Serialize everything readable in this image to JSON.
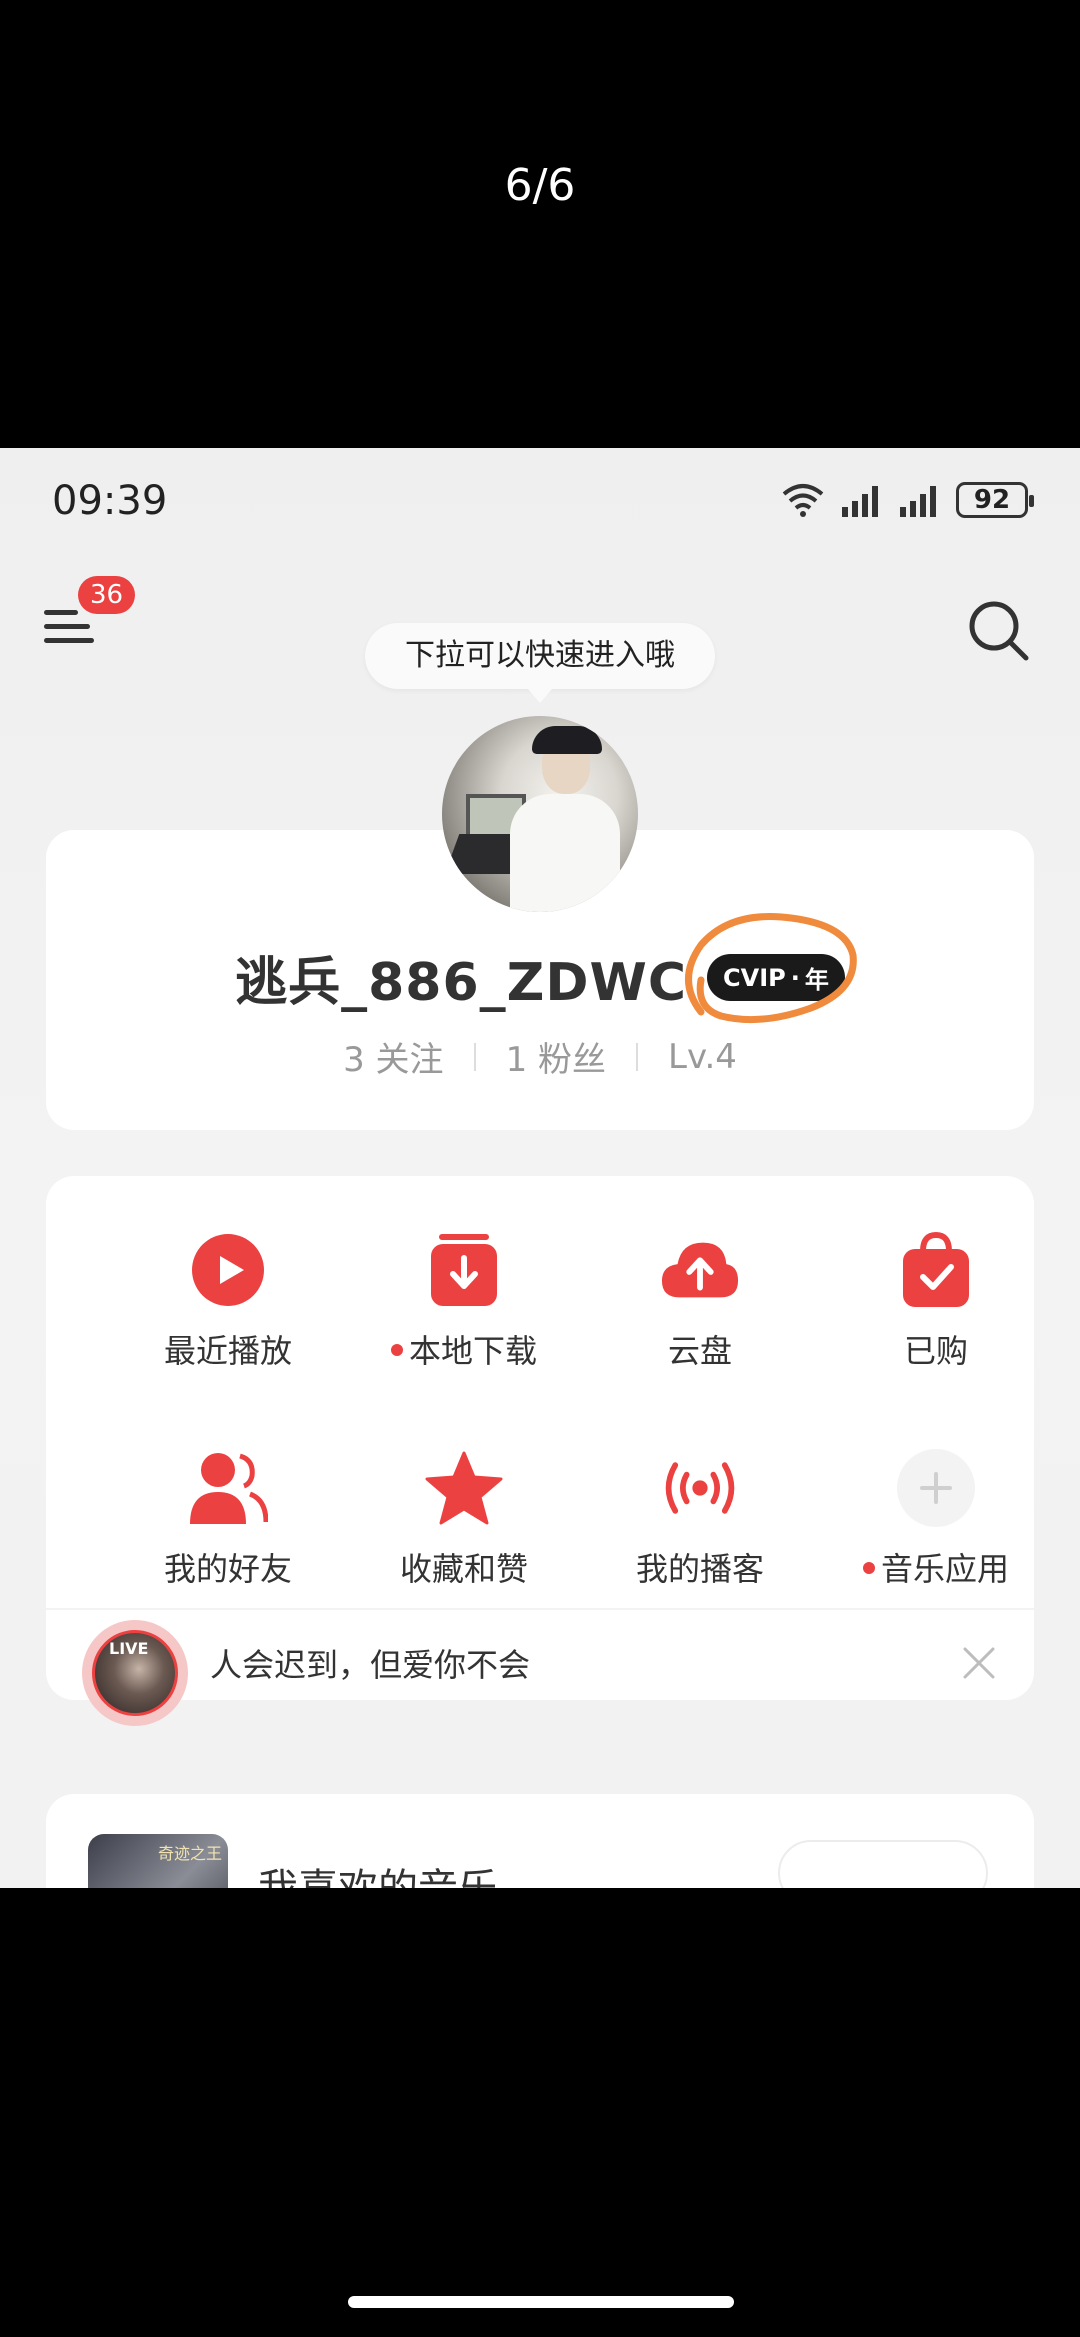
{
  "viewer": {
    "counter": "6/6"
  },
  "status_bar": {
    "time": "09:39",
    "battery": "92"
  },
  "header": {
    "menu_badge": "36",
    "tooltip": "下拉可以快速进入哦"
  },
  "profile": {
    "username": "逃兵_886_ZDWC",
    "vip_badge": {
      "logo": "CVIP",
      "sep": "·",
      "term": "年"
    },
    "stats": {
      "following": "3 关注",
      "followers": "1 粉丝",
      "level": "Lv.4"
    }
  },
  "functions": [
    {
      "label": "最近播放",
      "icon": "play-circle-icon",
      "dot": false
    },
    {
      "label": "本地下载",
      "icon": "download-box-icon",
      "dot": true
    },
    {
      "label": "云盘",
      "icon": "cloud-upload-icon",
      "dot": false
    },
    {
      "label": "已购",
      "icon": "shopping-bag-icon",
      "dot": false
    },
    {
      "label": "我的好友",
      "icon": "friends-icon",
      "dot": false
    },
    {
      "label": "收藏和赞",
      "icon": "star-icon",
      "dot": false
    },
    {
      "label": "我的播客",
      "icon": "broadcast-icon",
      "dot": false
    },
    {
      "label": "音乐应用",
      "icon": "plus-circle-icon",
      "dot": true
    }
  ],
  "live": {
    "tag": "LIVE",
    "text": "人会迟到，但爱你不会"
  },
  "music": {
    "title": "我喜欢的音乐",
    "cover_text": "奇迹之王"
  },
  "colors": {
    "accent": "#ec4141",
    "vip_bg": "#1a1a1a",
    "highlight_circle": "#f08a3c"
  }
}
